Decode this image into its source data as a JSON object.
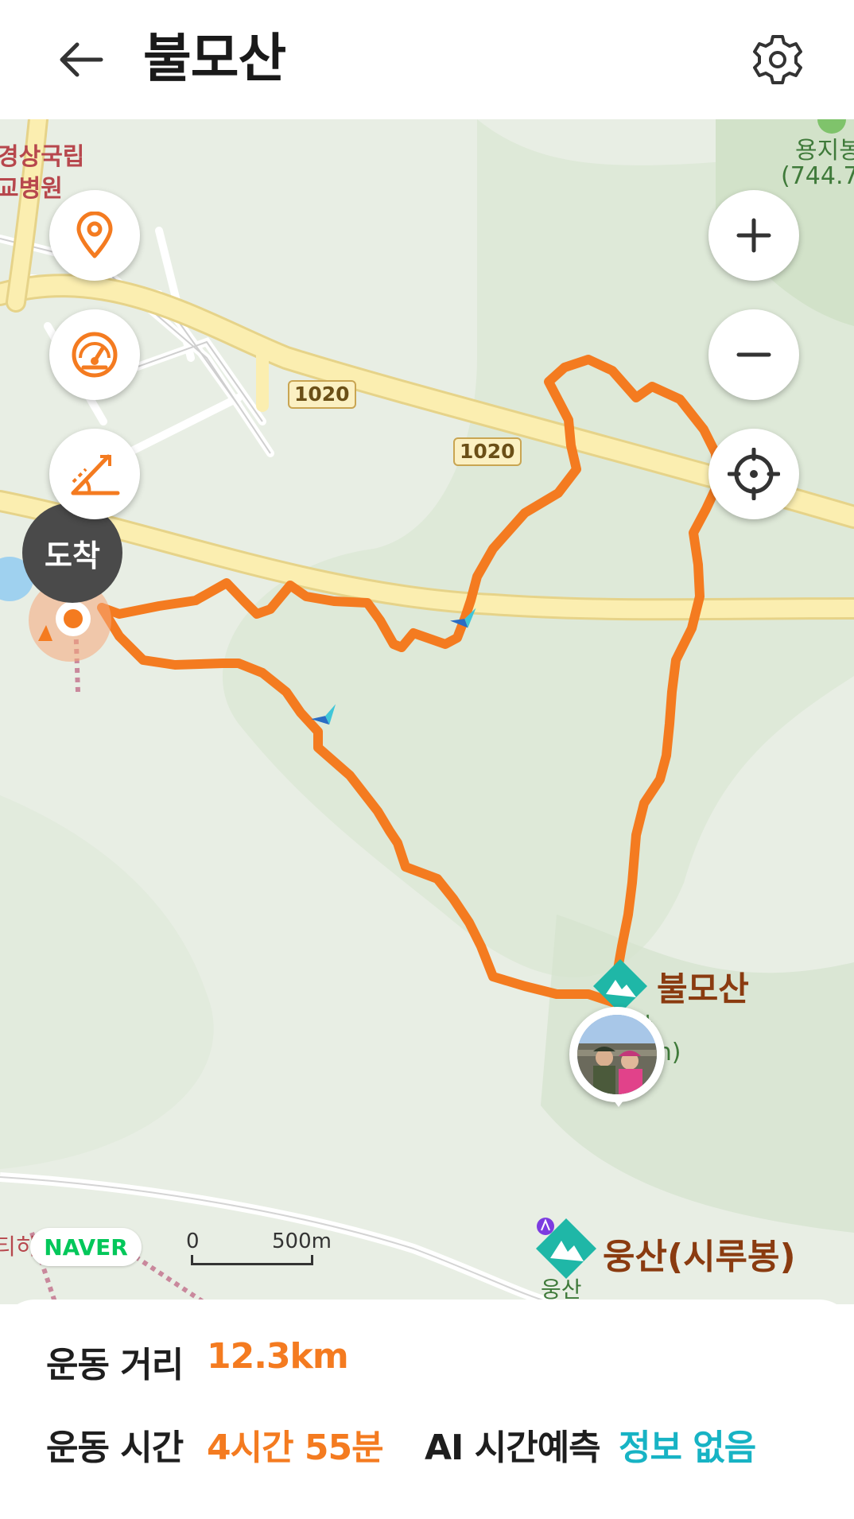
{
  "header": {
    "title": "불모산"
  },
  "map": {
    "labels": {
      "hospital": "경상국립",
      "hospital2": "교병원",
      "yongji_name": "용지봉",
      "yongji_height": "(744.7",
      "road1": "1020",
      "road2": "1020",
      "peak_title": "불모산",
      "peak_name": "불모산",
      "peak_height": "(801.1m)",
      "ungsan_title": "웅산(시루봉)",
      "ungsan_sub": "웅산",
      "left_cut": "티히"
    },
    "arrival_label": "도착",
    "naver_logo": "NAVER",
    "scale": {
      "zero": "0",
      "distance": "500m"
    },
    "route_color": "#f47b20"
  },
  "controls": {
    "location_icon": "map-pin-icon",
    "speed_icon": "speedometer-icon",
    "slope_icon": "slope-icon",
    "zoom_in_icon": "plus-icon",
    "zoom_out_icon": "minus-icon",
    "recenter_icon": "crosshair-icon"
  },
  "stats": {
    "distance_label": "운동 거리",
    "distance_value": "12.3km",
    "time_label": "운동 시간",
    "time_value": "4시간 55분",
    "ai_label": "AI 시간예측",
    "ai_value": "정보 없음"
  },
  "colors": {
    "accent_orange": "#f47b20",
    "accent_teal": "#17b3c4",
    "map_background": "#e9efe5"
  }
}
